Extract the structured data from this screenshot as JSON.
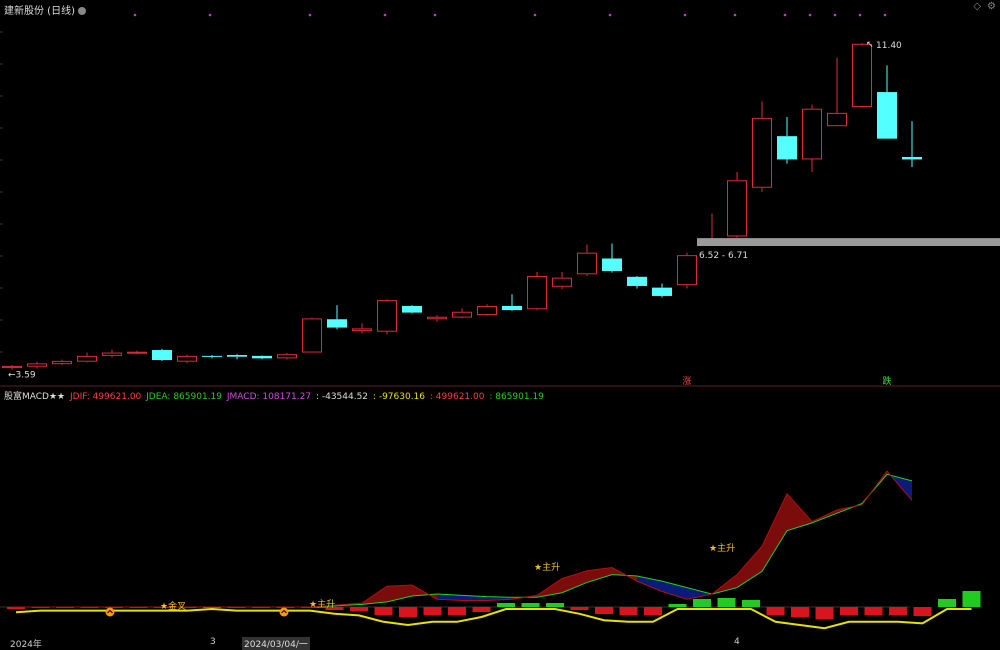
{
  "title": "建新股份 (日线)",
  "top_right_icons": [
    "diamond-icon",
    "gear-icon"
  ],
  "macd_header": {
    "name": "股富MACD★★",
    "jdif": "JDIF: 499621.00",
    "jdea": "JDEA: 865901.19",
    "jmacd": "JMACD: 108171.27",
    "v1": ": -43544.52",
    "v2": ": -97630.16",
    "v3": ": 499621.00",
    "v4": ": 865901.19"
  },
  "x_labels": [
    "2024年",
    "3",
    "2024/03/04/一",
    "4"
  ],
  "colors": {
    "up": "#e0283a",
    "down": "#54ffff",
    "jdif_text": "#ff3b3b",
    "jdea_text": "#21d11f",
    "jmacd_text": "#d24be0",
    "yellow": "#e8e000",
    "range_band": "#9a9a9a"
  },
  "chart_data": [
    {
      "type": "candlestick",
      "title": "建新股份 (日线)",
      "price_labels": {
        "high": "11.40",
        "low": "3.59",
        "range": "6.52 - 6.71",
        "rise": "涨",
        "fall": "跌"
      },
      "ylim": [
        3.3,
        12.0
      ],
      "candles": [
        {
          "o": 3.59,
          "c": 3.64,
          "h": 3.66,
          "l": 3.55
        },
        {
          "o": 3.62,
          "c": 3.7,
          "h": 3.74,
          "l": 3.58
        },
        {
          "o": 3.68,
          "c": 3.76,
          "h": 3.79,
          "l": 3.66
        },
        {
          "o": 3.74,
          "c": 3.88,
          "h": 3.96,
          "l": 3.72
        },
        {
          "o": 3.88,
          "c": 3.96,
          "h": 4.03,
          "l": 3.84
        },
        {
          "o": 3.96,
          "c": 3.98,
          "h": 4.01,
          "l": 3.92
        },
        {
          "o": 4.02,
          "c": 3.78,
          "h": 4.05,
          "l": 3.76
        },
        {
          "o": 3.74,
          "c": 3.88,
          "h": 3.91,
          "l": 3.7
        },
        {
          "o": 3.88,
          "c": 3.86,
          "h": 3.9,
          "l": 3.82
        },
        {
          "o": 3.9,
          "c": 3.86,
          "h": 3.92,
          "l": 3.8
        },
        {
          "o": 3.88,
          "c": 3.82,
          "h": 3.89,
          "l": 3.8
        },
        {
          "o": 3.82,
          "c": 3.92,
          "h": 3.95,
          "l": 3.79
        },
        {
          "o": 3.96,
          "c": 4.78,
          "h": 4.8,
          "l": 3.96
        },
        {
          "o": 4.76,
          "c": 4.56,
          "h": 5.1,
          "l": 4.52
        },
        {
          "o": 4.48,
          "c": 4.54,
          "h": 4.66,
          "l": 4.42
        },
        {
          "o": 4.46,
          "c": 5.22,
          "h": 5.24,
          "l": 4.4
        },
        {
          "o": 5.08,
          "c": 4.92,
          "h": 5.1,
          "l": 4.9
        },
        {
          "o": 4.76,
          "c": 4.82,
          "h": 4.86,
          "l": 4.7
        },
        {
          "o": 4.8,
          "c": 4.94,
          "h": 5.02,
          "l": 4.78
        },
        {
          "o": 4.86,
          "c": 5.08,
          "h": 5.12,
          "l": 4.84
        },
        {
          "o": 5.08,
          "c": 4.98,
          "h": 5.36,
          "l": 4.96
        },
        {
          "o": 5.0,
          "c": 5.8,
          "h": 5.9,
          "l": 4.98
        },
        {
          "o": 5.54,
          "c": 5.76,
          "h": 5.9,
          "l": 5.48
        },
        {
          "o": 5.84,
          "c": 6.36,
          "h": 6.56,
          "l": 5.8
        },
        {
          "o": 6.22,
          "c": 5.92,
          "h": 6.58,
          "l": 5.88
        },
        {
          "o": 5.78,
          "c": 5.56,
          "h": 5.8,
          "l": 5.5
        },
        {
          "o": 5.52,
          "c": 5.32,
          "h": 5.62,
          "l": 5.28
        },
        {
          "o": 5.58,
          "c": 6.3,
          "h": 6.36,
          "l": 5.5
        },
        {
          "o": 6.62,
          "c": 6.7,
          "h": 7.3,
          "l": 6.52
        },
        {
          "o": 6.75,
          "c": 8.1,
          "h": 8.3,
          "l": 6.72
        },
        {
          "o": 7.92,
          "c": 9.6,
          "h": 10.0,
          "l": 7.82
        },
        {
          "o": 9.16,
          "c": 8.6,
          "h": 9.62,
          "l": 8.5
        },
        {
          "o": 8.6,
          "c": 9.82,
          "h": 9.92,
          "l": 8.3
        },
        {
          "o": 9.4,
          "c": 9.72,
          "h": 11.05,
          "l": 9.4
        },
        {
          "o": 9.86,
          "c": 11.38,
          "h": 11.4,
          "l": 9.84
        },
        {
          "o": 10.22,
          "c": 9.1,
          "h": 10.86,
          "l": 9.1
        },
        {
          "o": 8.66,
          "c": 8.6,
          "h": 9.52,
          "l": 8.42
        }
      ]
    },
    {
      "type": "line",
      "title": "股富MACD★★",
      "ylim": [
        -70,
        320
      ],
      "series": [
        {
          "name": "JDIF",
          "values": [
            0,
            0,
            0,
            0,
            0,
            0,
            0,
            0,
            0,
            0,
            0,
            0,
            0,
            3,
            6,
            32,
            34,
            12,
            10,
            10,
            12,
            18,
            44,
            56,
            61,
            40,
            24,
            12,
            20,
            50,
            94,
            175,
            132,
            150,
            158,
            210,
            165
          ]
        },
        {
          "name": "JDEA",
          "values": [
            0,
            0,
            0,
            0,
            0,
            0,
            0,
            0,
            0,
            0,
            0,
            0,
            0,
            2,
            4,
            8,
            17,
            20,
            18,
            16,
            15,
            15,
            22,
            38,
            50,
            48,
            40,
            30,
            20,
            30,
            55,
            118,
            130,
            145,
            160,
            205,
            195
          ]
        }
      ],
      "hist": [
        -2,
        -1,
        -1,
        -1,
        -1,
        -1,
        -1,
        -1,
        0,
        -1,
        -1,
        -1,
        -1,
        -3,
        -4,
        -8,
        -10,
        -8,
        -8,
        -5,
        4,
        4,
        4,
        -3,
        -7,
        -8,
        -8,
        3,
        8,
        9,
        7,
        -8,
        -10,
        -12,
        -8,
        -8,
        -8,
        -9,
        8,
        16
      ],
      "annotations": [
        "★金叉",
        "★主升",
        "★主升",
        "★主升"
      ]
    }
  ]
}
